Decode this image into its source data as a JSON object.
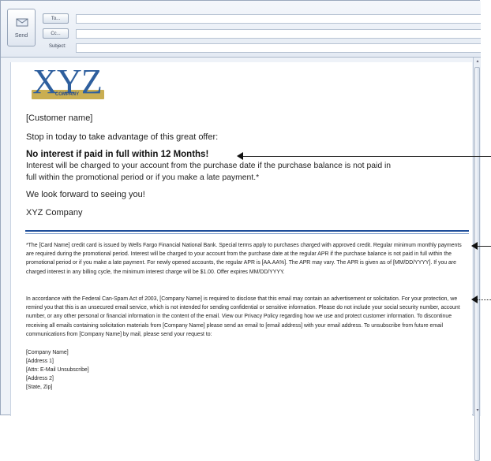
{
  "header": {
    "send_label": "Send",
    "to_label": "To...",
    "cc_label": "Cc...",
    "subject_label": "Subject:"
  },
  "logo": {
    "text": "XYZ",
    "subtext": "COMPANY"
  },
  "body": {
    "customer_name": "[Customer name]",
    "intro": "Stop in today to take advantage of this great offer:",
    "offer_headline": "No interest if paid in full within 12 Months!",
    "interest_line1": "Interest will be charged to your account from the purchase date if the purchase balance is not paid in",
    "interest_line2": "full within the promotional period or if you make a late payment.*",
    "closing": "We look forward to seeing you!",
    "signature": "XYZ Company"
  },
  "disclosure": {
    "para1": "*The [Card Name] credit card is issued by Wells Fargo Financial National Bank. Special terms apply to purchases charged with approved credit. Regular minimum monthly payments are required during the promotional period. Interest will be charged to your account from the purchase date at the regular APR if the purchase balance is not paid in full within the promotional period or if you make a late payment. For newly opened accounts, the regular APR is [AA.AA%]. The APR may vary. The APR is given as of [MM/DD/YYYY]. If you are charged interest in any billing cycle, the minimum interest charge will be $1.00. Offer expires MM/DD/YYYY.",
    "para2": "In accordance with the Federal Can-Spam Act of 2003, [Company Name] is required to disclose that this email may contain an advertisement or solicitation. For your protection, we remind you that this is an unsecured email service, which is not intended for sending confidential or sensitive information. Please do not include your social security number, account number, or any other personal or financial information in the content of the email. View our Privacy Policy regarding how we use and protect customer information. To discontinue receiving all emails containing solicitation materials from [Company Name] please send an email to [email address] with your email address. To unsubscribe from future email communications from [Company Name] by mail, please send your request to:",
    "address": [
      "[Company Name]",
      "[Address 1]",
      "[Attn: E-Mail Unsubscribe]",
      "[Address 2]",
      "[State, Zip]"
    ]
  }
}
